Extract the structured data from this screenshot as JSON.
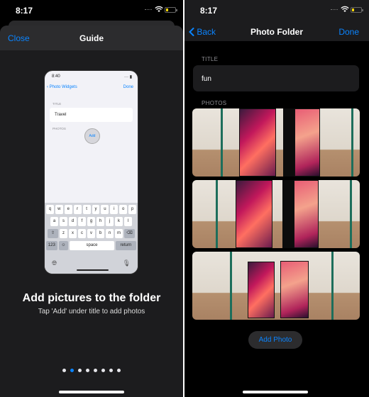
{
  "left": {
    "status": {
      "time": "8:17"
    },
    "nav": {
      "close_label": "Close",
      "title": "Guide"
    },
    "mockup": {
      "time": "8:40",
      "back_label": "Photo Widgets",
      "done_label": "Done",
      "title_label": "TITLE",
      "title_value": "Travel",
      "photos_label": "PHOTOS",
      "add_label": "Add",
      "keyboard": {
        "row1": [
          "q",
          "w",
          "e",
          "r",
          "t",
          "y",
          "u",
          "i",
          "o",
          "p"
        ],
        "row2": [
          "a",
          "s",
          "d",
          "f",
          "g",
          "h",
          "j",
          "k",
          "l"
        ],
        "row3": [
          "z",
          "x",
          "c",
          "v",
          "b",
          "n",
          "m"
        ],
        "numbers_label": "123",
        "space_label": "space",
        "return_label": "return"
      }
    },
    "guide": {
      "heading": "Add pictures to the folder",
      "subtitle": "Tap 'Add' under title to add photos"
    },
    "pager": {
      "total": 8,
      "current": 2
    }
  },
  "right": {
    "status": {
      "time": "8:17"
    },
    "nav": {
      "back_label": "Back",
      "title": "Photo Folder",
      "done_label": "Done"
    },
    "title_section_label": "TITLE",
    "title_value": "fun",
    "photos_section_label": "PHOTOS",
    "photos": [
      {
        "description": "two red-wallpaper phones behind glass, close-up"
      },
      {
        "description": "two red-wallpaper phones behind glass, close-up"
      },
      {
        "description": "two phones standing on wooden table inside glass case"
      }
    ],
    "add_photo_label": "Add Photo"
  },
  "colors": {
    "accent": "#0a84ff",
    "background": "#000000",
    "surface": "#1c1c1e",
    "battery": "#ffd60a"
  }
}
